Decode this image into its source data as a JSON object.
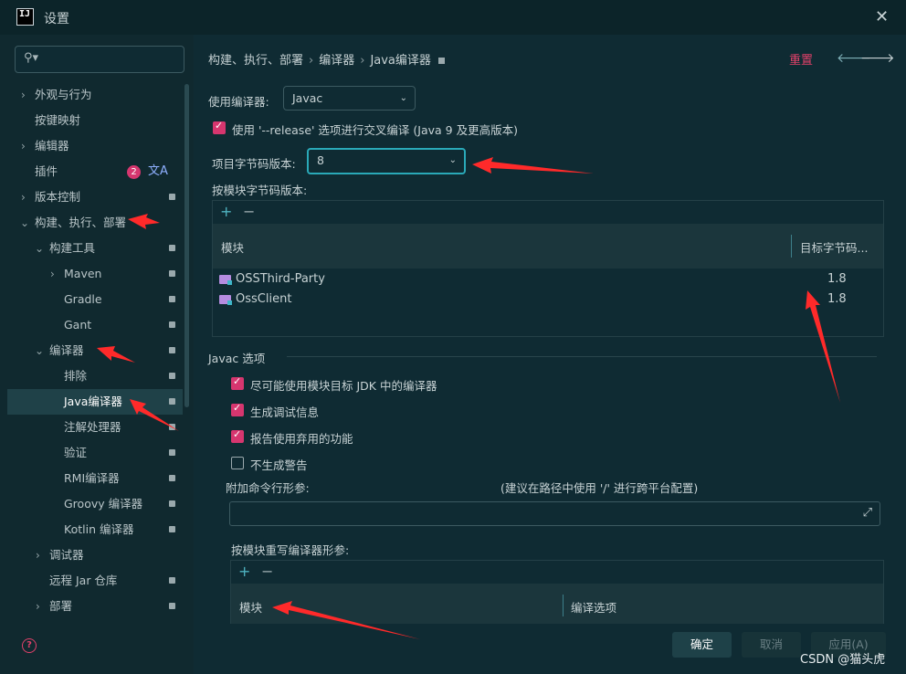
{
  "window": {
    "title": "设置",
    "app_icon_text": "IJ"
  },
  "sidebar": {
    "search": {
      "placeholder": ""
    },
    "items": [
      {
        "label": "外观与行为"
      },
      {
        "label": "按键映射"
      },
      {
        "label": "编辑器"
      },
      {
        "label": "插件",
        "badge": "2"
      },
      {
        "label": "版本控制"
      },
      {
        "label": "构建、执行、部署"
      },
      {
        "label": "构建工具"
      },
      {
        "label": "Maven"
      },
      {
        "label": "Gradle"
      },
      {
        "label": "Gant"
      },
      {
        "label": "编译器"
      },
      {
        "label": "排除"
      },
      {
        "label": "Java编译器"
      },
      {
        "label": "注解处理器"
      },
      {
        "label": "验证"
      },
      {
        "label": "RMI编译器"
      },
      {
        "label": "Groovy 编译器"
      },
      {
        "label": "Kotlin 编译器"
      },
      {
        "label": "调试器"
      },
      {
        "label": "远程 Jar 仓库"
      },
      {
        "label": "部署"
      }
    ]
  },
  "breadcrumb": {
    "part1": "构建、执行、部署",
    "sep": "›",
    "part2": "编译器",
    "part3": "Java编译器"
  },
  "header": {
    "reset": "重置",
    "back": "🡐",
    "forward": "🡒"
  },
  "compiler": {
    "use_label": "使用编译器:",
    "use_value": "Javac",
    "release_checkbox": "使用 '--release' 选项进行交叉编译 (Java 9 及更高版本)",
    "bytecode_label": "项目字节码版本:",
    "bytecode_value": "8",
    "per_module_label": "按模块字节码版本:",
    "table": {
      "col_module": "模块",
      "col_target": "目标字节码...",
      "rows": [
        {
          "module": "OSSThird-Party",
          "target": "1.8"
        },
        {
          "module": "OssClient",
          "target": "1.8"
        }
      ]
    }
  },
  "javac": {
    "section_title": "Javac 选项",
    "options": [
      {
        "label": "尽可能使用模块目标 JDK 中的编译器",
        "checked": true
      },
      {
        "label": "生成调试信息",
        "checked": true
      },
      {
        "label": "报告使用弃用的功能",
        "checked": true
      },
      {
        "label": "不生成警告",
        "checked": false
      }
    ],
    "extra_args_label": "附加命令行形参:",
    "extra_args_hint": "(建议在路径中使用 '/' 进行跨平台配置)",
    "override_label": "按模块重写编译器形参:",
    "override_table": {
      "col_module": "模块",
      "col_options": "编译选项"
    }
  },
  "toolbar": {
    "add": "+",
    "remove": "−"
  },
  "buttons": {
    "ok": "确定",
    "cancel": "取消",
    "apply": "应用(A)"
  },
  "watermark": "CSDN @猫头虎",
  "colors": {
    "accent": "#d6366f",
    "focus": "#2aa9b8",
    "annotation_arrow": "#ff2a2a"
  }
}
